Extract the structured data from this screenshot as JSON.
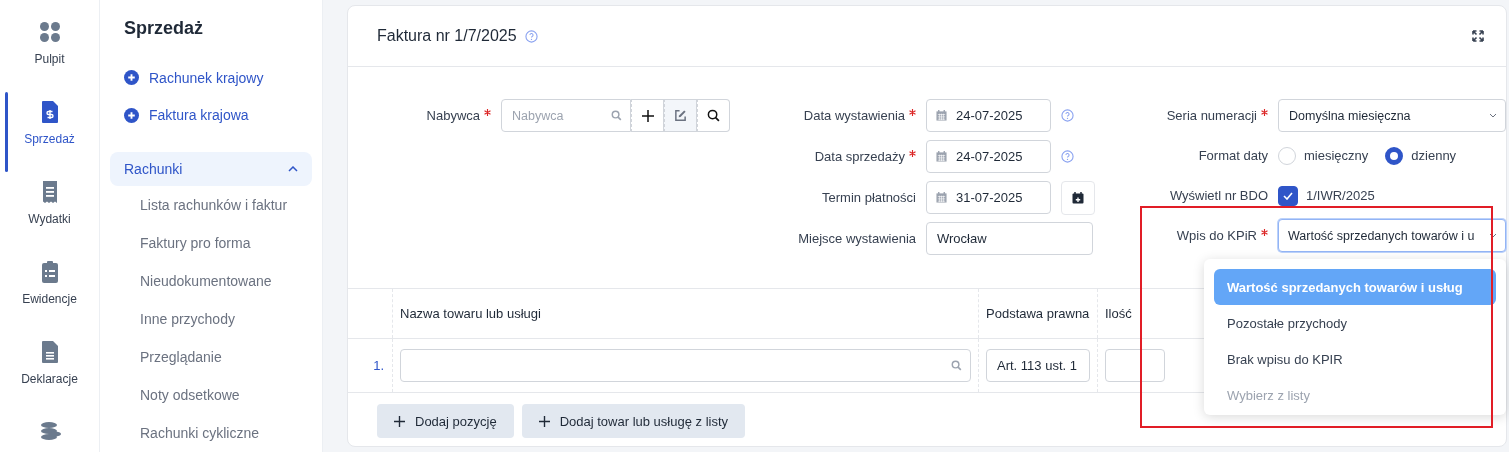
{
  "rail": {
    "items": [
      {
        "label": "Pulpit",
        "selected": false
      },
      {
        "label": "Sprzedaż",
        "selected": true
      },
      {
        "label": "Wydatki",
        "selected": false
      },
      {
        "label": "Ewidencje",
        "selected": false
      },
      {
        "label": "Deklaracje",
        "selected": false
      },
      {
        "selected": false
      }
    ]
  },
  "sidebar": {
    "title": "Sprzedaż",
    "actions": [
      "Rachunek krajowy",
      "Faktura krajowa"
    ],
    "group": {
      "label": "Rachunki",
      "expanded": true,
      "items": [
        "Lista rachunków i faktur",
        "Faktury pro forma",
        "Nieudokumentowane",
        "Inne przychody",
        "Przeglądanie",
        "Noty odsetkowe",
        "Rachunki cykliczne"
      ]
    }
  },
  "invoice": {
    "title": "Faktura nr 1/7/2025",
    "buyer": {
      "label": "Nabywca",
      "required": true,
      "placeholder": "Nabywca"
    },
    "dates": [
      {
        "kind": "date",
        "label": "Data wystawienia",
        "required": true,
        "value": "24-07-2025",
        "help": true
      },
      {
        "kind": "date",
        "label": "Data sprzedaży",
        "required": true,
        "value": "24-07-2025",
        "help": true
      },
      {
        "kind": "date",
        "label": "Termin płatności",
        "required": false,
        "value": "31-07-2025",
        "help": false,
        "picker": true
      },
      {
        "kind": "text",
        "label": "Miejsce wystawienia",
        "required": false,
        "value": "Wrocław"
      }
    ],
    "settings": [
      {
        "kind": "select",
        "label": "Seria numeracji",
        "required": true,
        "value": "Domyślna miesięczna"
      },
      {
        "kind": "radio",
        "label": "Format daty",
        "options": [
          {
            "label": "miesięczny",
            "selected": false
          },
          {
            "label": "dzienny",
            "selected": true
          }
        ]
      },
      {
        "kind": "checkbox",
        "label": "Wyświetl nr BDO",
        "checked": true,
        "value": "1/IWR/2025"
      },
      {
        "kind": "select",
        "label": "Wpis do KPiR",
        "required": true,
        "value": "Wartość sprzedanych towarów i u",
        "open": true,
        "highlighted": true,
        "options": [
          {
            "label": "Wartość sprzedanych towarów i usług",
            "selected": true,
            "disabled": false
          },
          {
            "label": "Pozostałe przychody",
            "selected": false,
            "disabled": false
          },
          {
            "label": "Brak wpisu do KPIR",
            "selected": false,
            "disabled": false
          },
          {
            "label": "Wybierz z listy",
            "selected": false,
            "disabled": true
          }
        ]
      }
    ],
    "table": {
      "columns": [
        "Nazwa towaru lub usługi",
        "Podstawa prawna",
        "Ilość"
      ],
      "rows": [
        {
          "number": "1.",
          "legal_basis": "Art. 113 ust. 1"
        }
      ]
    },
    "buttons": [
      "Dodaj pozycję",
      "Dodaj towar lub usługę z listy"
    ]
  }
}
